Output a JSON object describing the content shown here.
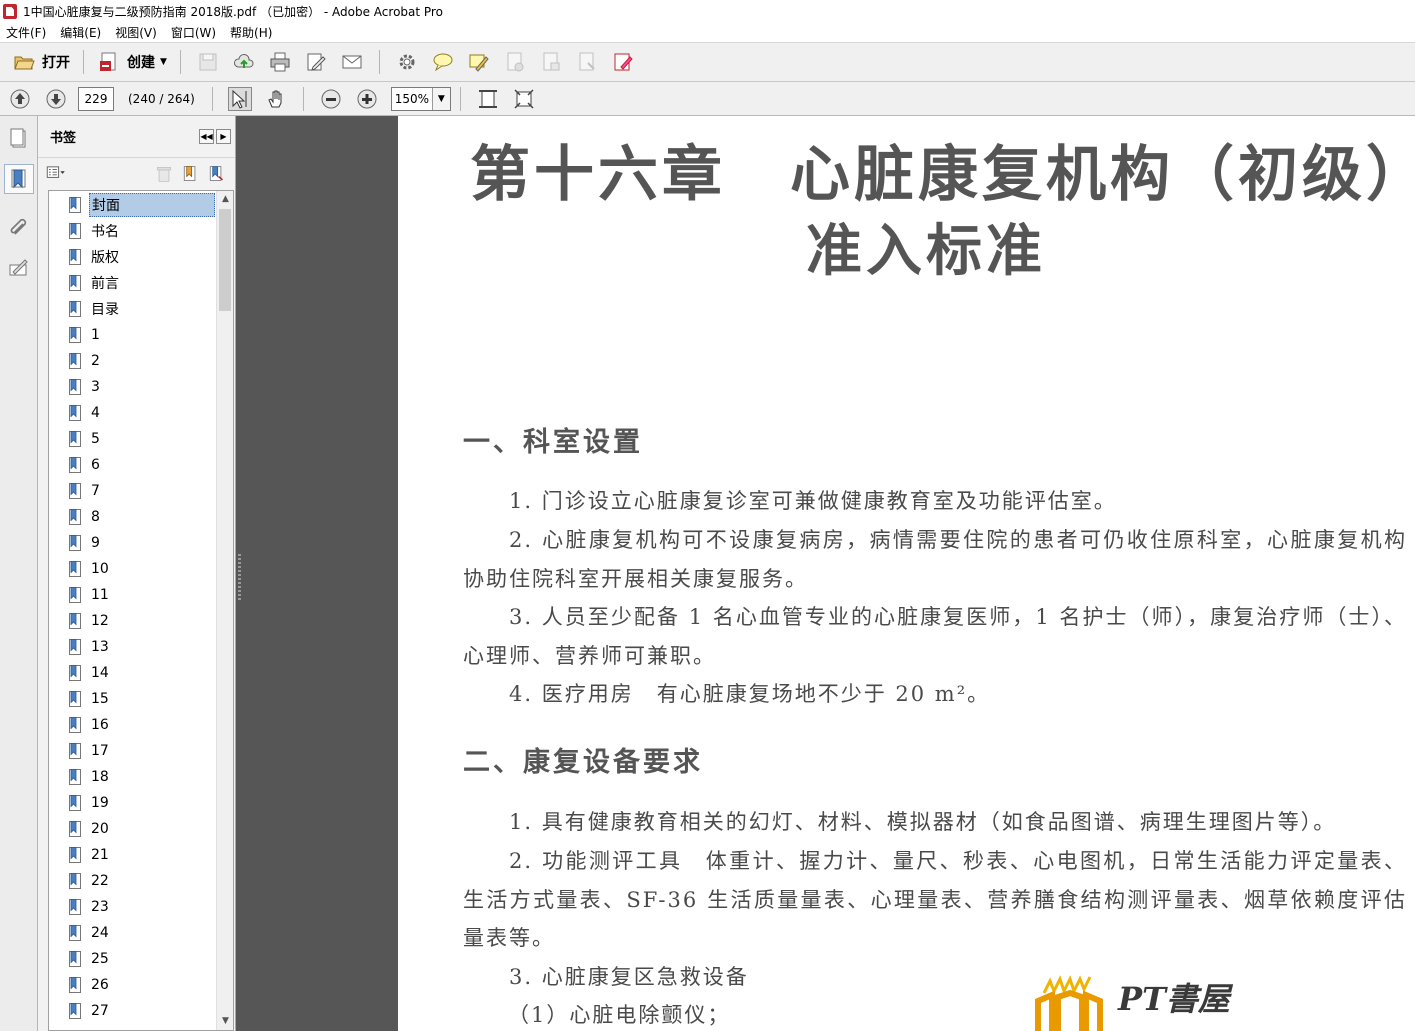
{
  "window": {
    "title": "1中国心脏康复与二级预防指南 2018版.pdf （已加密） - Adobe Acrobat Pro"
  },
  "menu": [
    "文件(F)",
    "编辑(E)",
    "视图(V)",
    "窗口(W)",
    "帮助(H)"
  ],
  "toolbar": {
    "open_label": "打开",
    "create_label": "创建"
  },
  "nav": {
    "page_value": "229",
    "page_count": "(240 / 264)",
    "zoom_value": "150%"
  },
  "bookmarks": {
    "title": "书签",
    "items": [
      "封面",
      "书名",
      "版权",
      "前言",
      "目录",
      "1",
      "2",
      "3",
      "4",
      "5",
      "6",
      "7",
      "8",
      "9",
      "10",
      "11",
      "12",
      "13",
      "14",
      "15",
      "16",
      "17",
      "18",
      "19",
      "20",
      "21",
      "22",
      "23",
      "24",
      "25",
      "26",
      "27"
    ],
    "selected": "封面"
  },
  "document": {
    "chapter_title_line1": "第十六章　心脏康复机构（初级）",
    "chapter_title_line2": "准入标准",
    "section1_heading": "一、科室设置",
    "s1_p1": "1. 门诊设立心脏康复诊室可兼做健康教育室及功能评估室。",
    "s1_p2": "2. 心脏康复机构可不设康复病房，病情需要住院的患者可仍收住原科室，心脏康复机构协助住院科室开展相关康复服务。",
    "s1_p3": "3. 人员至少配备 1 名心血管专业的心脏康复医师，1 名护士（师），康复治疗师（士）、心理师、营养师可兼职。",
    "s1_p4": "4. 医疗用房　有心脏康复场地不少于 20 m²。",
    "section2_heading": "二、康复设备要求",
    "s2_p1": "1. 具有健康教育相关的幻灯、材料、模拟器材（如食品图谱、病理生理图片等）。",
    "s2_p2": "2. 功能测评工具　体重计、握力计、量尺、秒表、心电图机，日常生活能力评定量表、生活方式量表、SF-36 生活质量量表、心理量表、营养膳食结构测评量表、烟草依赖度评估量表等。",
    "s2_p3": "3. 心脏康复区急救设备",
    "s2_p4": "（1）心脏电除颤仪；",
    "watermark": "PT書屋"
  }
}
